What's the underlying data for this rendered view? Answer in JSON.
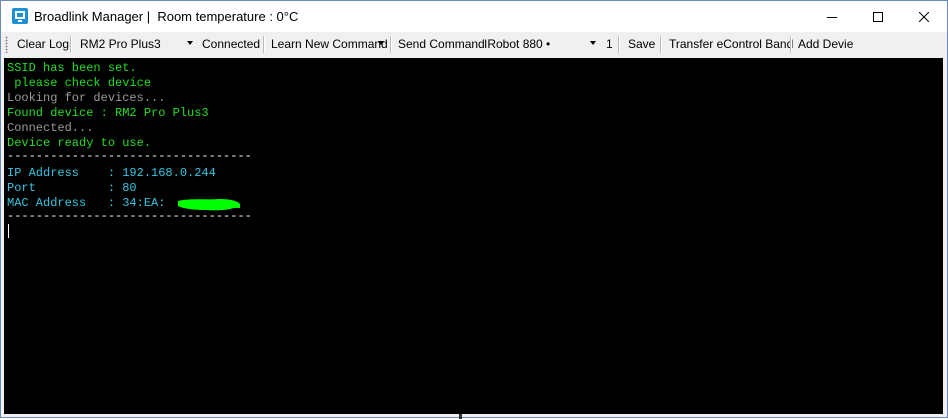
{
  "window": {
    "title": "Broadlink Manager |  Room temperature : 0°C",
    "minimize": "minimize",
    "maximize": "maximize",
    "close": "close"
  },
  "toolbar": {
    "clear_log": "Clear Log",
    "device_select": "RM2 Pro Plus3",
    "connected": "Connected",
    "learn_new_command": "Learn New Command",
    "send_command": "Send Command",
    "command_select": "IRobot 880 •",
    "count_value": "1",
    "save": "Save",
    "transfer": "Transfer eControl Band",
    "add_device": "Add Devie"
  },
  "console": {
    "lines": [
      {
        "text": "SSID has been set.",
        "color": "green"
      },
      {
        "text": " please check device",
        "color": "green"
      },
      {
        "text": "Looking for devices...",
        "color": "gray"
      },
      {
        "text": "Found device : RM2 Pro Plus3",
        "color": "green"
      },
      {
        "text": "Connected...",
        "color": "gray"
      },
      {
        "text": "Device ready to use.",
        "color": "green"
      },
      {
        "text": "----------------------------------",
        "color": "white"
      },
      {
        "text": "IP Address    : ",
        "value": "192.168.0.244"
      },
      {
        "text": "Port          : ",
        "value": "80"
      },
      {
        "text": "MAC Address   : ",
        "value": "34:EA:"
      },
      {
        "text": "----------------------------------",
        "color": "white"
      }
    ]
  },
  "colors": {
    "console_bg": "#000000",
    "green": "#22dd22",
    "gray": "#9a9a9a",
    "cyan": "#35c4e3",
    "redaction": "#00ff00"
  }
}
